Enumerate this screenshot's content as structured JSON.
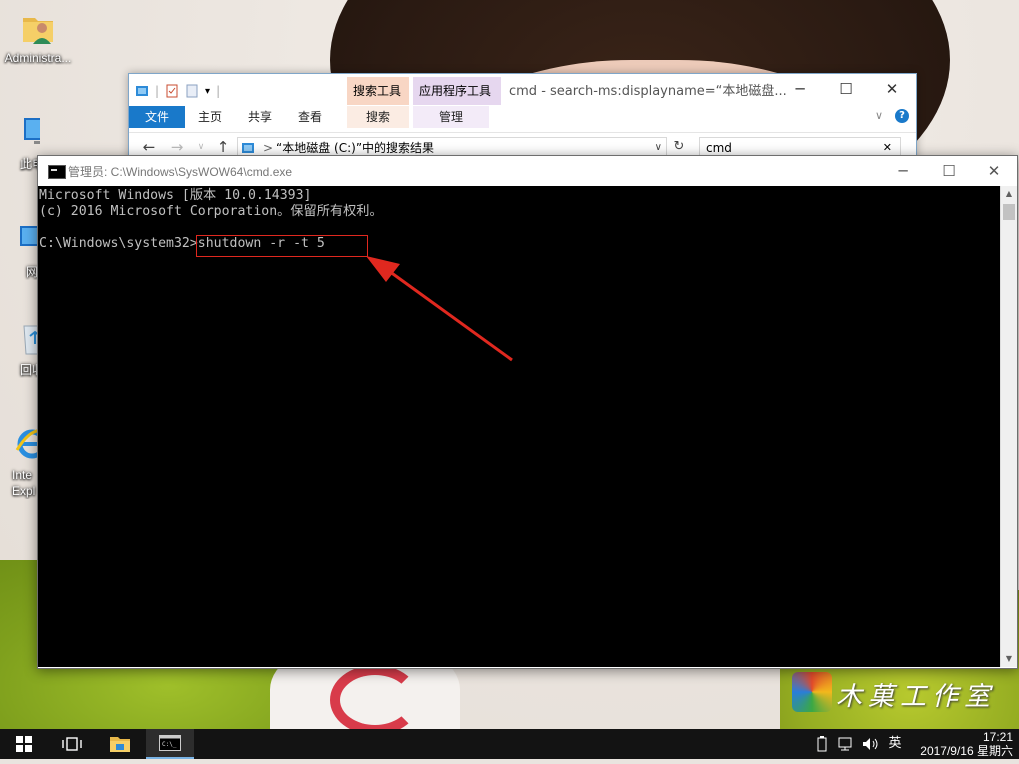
{
  "desktop": {
    "icons": [
      {
        "label": "Administra...",
        "name": "user-folder-icon"
      },
      {
        "label": "此电",
        "name": "this-pc-icon"
      },
      {
        "label": "网",
        "name": "network-icon"
      },
      {
        "label": "回收",
        "name": "recycle-bin-icon"
      },
      {
        "label": "Inte Expl",
        "name": "internet-explorer-icon"
      }
    ],
    "watermark_text": "木菓工作室"
  },
  "explorer": {
    "qat_separator": "|",
    "context_tabs": [
      {
        "group": "搜索工具",
        "tab": "搜索",
        "color": "#f8d6c4"
      },
      {
        "group": "应用程序工具",
        "tab": "管理",
        "color": "#e6d7ef"
      }
    ],
    "title": "cmd - search-ms:displayname=“本地磁盘...",
    "ribbon_tabs": [
      "文件",
      "主页",
      "共享",
      "查看"
    ],
    "address": "“本地磁盘 (C:)”中的搜索结果",
    "address_separator": ">",
    "search_value": "cmd",
    "minimize": "─",
    "maximize": "☐",
    "close": "✕",
    "collapse_icon": "∨",
    "help_icon": "?",
    "back": "←",
    "forward": "→",
    "up": "↑",
    "refresh": "↻",
    "dropdown": "∨",
    "clear_search": "✕",
    "accent": "#1979ca"
  },
  "cmd": {
    "title": "管理员: C:\\Windows\\SysWOW64\\cmd.exe",
    "lines": [
      "Microsoft Windows [版本 10.0.14393]",
      "(c) 2016 Microsoft Corporation。保留所有权利。",
      "",
      "C:\\Windows\\system32>shutdown -r -t 5"
    ],
    "minimize": "─",
    "maximize": "☐",
    "close": "✕",
    "scroll_up": "▲",
    "scroll_down": "▼",
    "annotation_color": "#e0281f"
  },
  "taskbar": {
    "ime": "英",
    "time": "17:21",
    "date": "2017/9/16 星期六"
  }
}
